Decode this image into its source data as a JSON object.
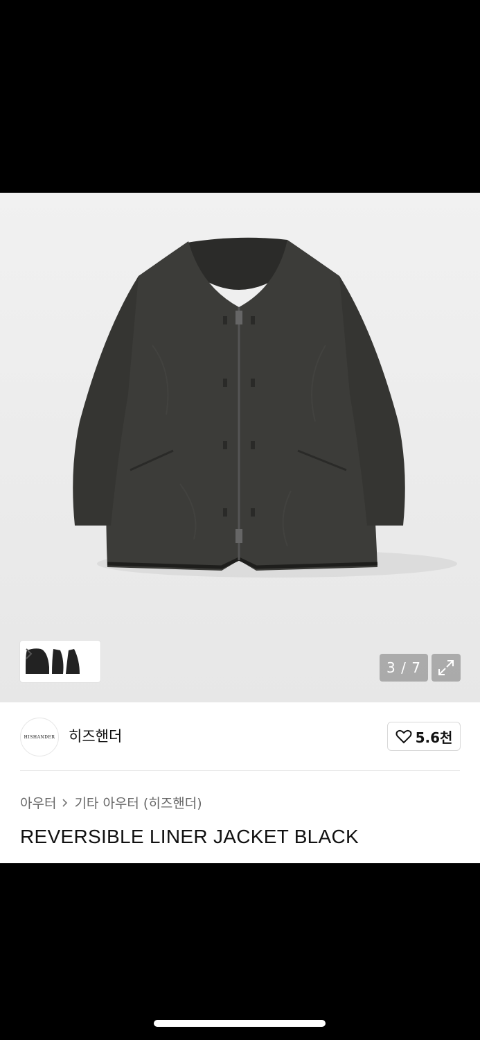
{
  "gallery": {
    "counter": "3 / 7",
    "thumbnail_icon": "jacket-thumbnails",
    "expand_icon": "expand-icon"
  },
  "brand": {
    "logo_text": "HISHANDER",
    "name": "히즈핸더"
  },
  "like": {
    "icon": "heart-outline-icon",
    "count": "5.6천"
  },
  "breadcrumb": {
    "category": "아우터",
    "subcategory": "기타 아우터 (히즈핸더)"
  },
  "product": {
    "title": "REVERSIBLE LINER JACKET BLACK"
  },
  "colors": {
    "jacket": "#3a3a37",
    "background": "#ececec"
  }
}
